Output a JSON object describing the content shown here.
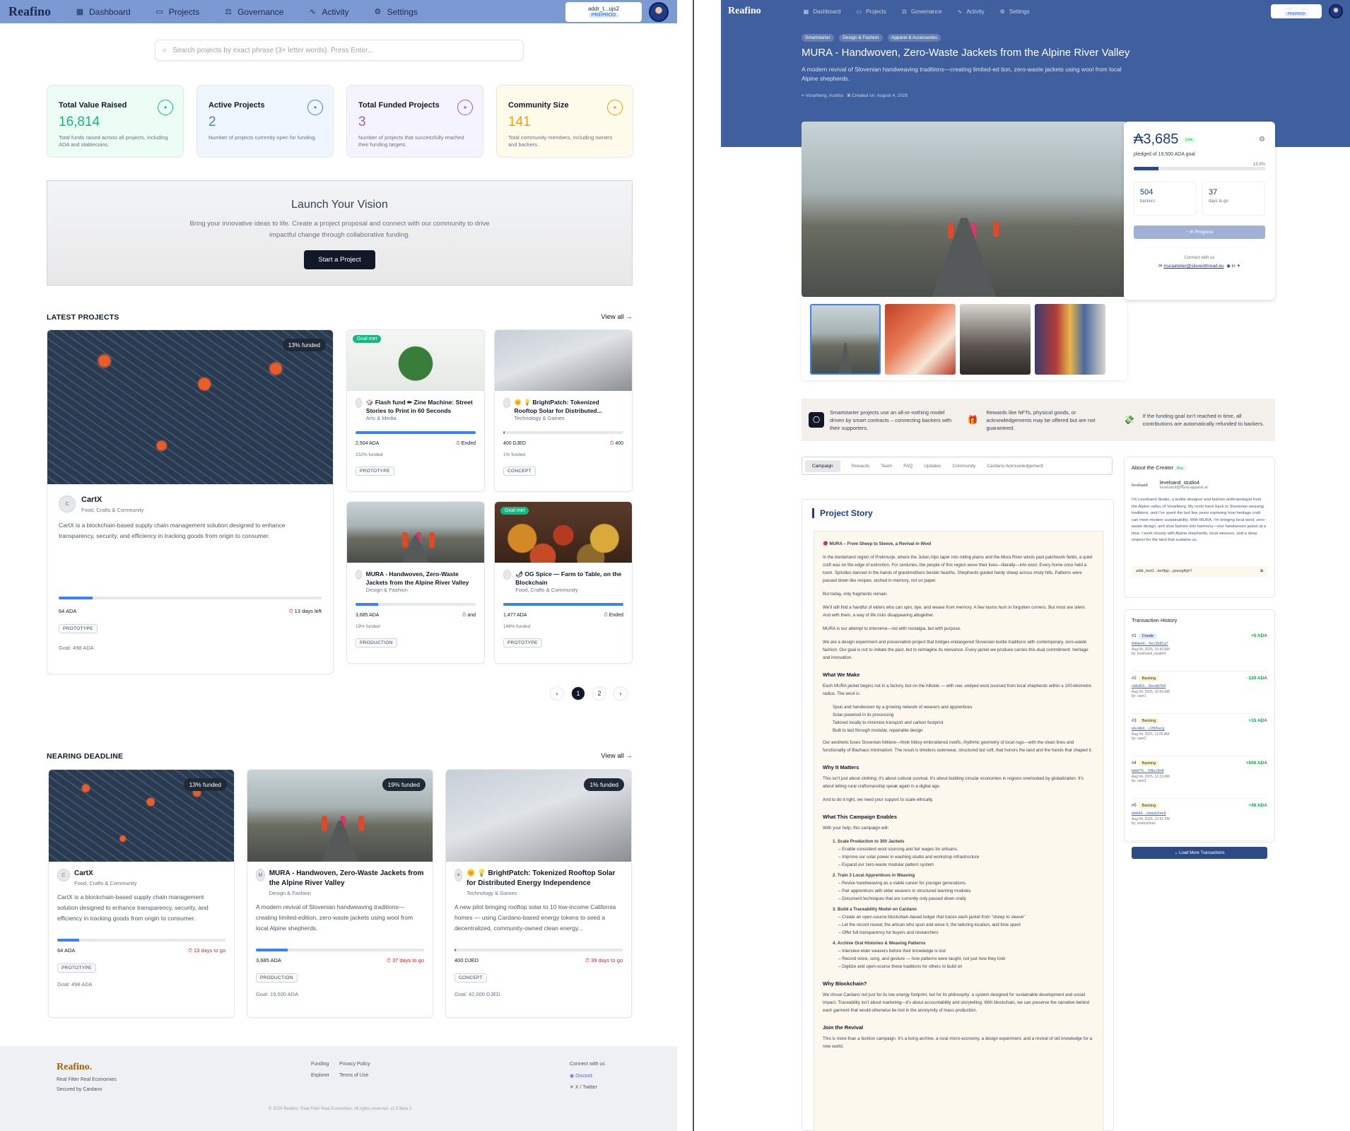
{
  "left": {
    "nav": {
      "logo": "Reafino",
      "items": [
        "Dashboard",
        "Projects",
        "Governance",
        "Activity",
        "Settings"
      ],
      "wallet_addr": "addr_t...ujs2",
      "wallet_net": "PREPROD"
    },
    "search": {
      "placeholder": "Search projects by exact phrase (3+ letter words). Press Enter..."
    },
    "stats": [
      {
        "title": "Total Value Raised",
        "value": "16,814",
        "desc": "Total funds raised across all projects, including ADA and stablecoins.",
        "color": "#10b981",
        "bg": "#ecfdf5",
        "icon": "coins-icon"
      },
      {
        "title": "Active Projects",
        "value": "2",
        "desc": "Number of projects currently open for funding.",
        "color": "#3b82f6",
        "bg": "#eff6ff",
        "icon": "activity-icon"
      },
      {
        "title": "Total Funded Projects",
        "value": "3",
        "desc": "Number of projects that successfully reached their funding targets.",
        "color": "#8b5cf6",
        "bg": "#f5f3ff",
        "icon": "check-circle-icon"
      },
      {
        "title": "Community Size",
        "value": "141",
        "desc": "Total community members, including owners and backers.",
        "color": "#f59e0b",
        "bg": "#fffbeb",
        "icon": "users-icon"
      }
    ],
    "launch": {
      "title": "Launch Your Vision",
      "text": "Bring your innovative ideas to life. Create a project proposal and connect with our community to drive impactful change through collaborative funding.",
      "button": "Start a Project"
    },
    "latest": {
      "heading": "LATEST PROJECTS",
      "view_all": "View all →",
      "featured": {
        "badge": "13% funded",
        "avatar": "C",
        "title": "CartX",
        "category": "Food, Crafts & Community",
        "desc": "CartX is a blockchain-based supply chain management solution designed to enhance transparency, security, and efficiency in tracking goods from origin to consumer.",
        "amount": "64 ADA",
        "left": "13 days left",
        "stage": "PROTOTYPE",
        "goal": "Goal: 498 ADA",
        "progress": 0.13
      },
      "cards": [
        {
          "goal_badge": "Goal met",
          "title": "🎲 Flash fund ✏ Zine Machine: Street Stories to Print in 60 Seconds",
          "category": "Arts & Media",
          "amount": "2,504 ADA",
          "status": "Ended",
          "funded": "232% funded",
          "stage": "PROTOTYPE",
          "progress": 1.0
        },
        {
          "goal_badge": "",
          "title": "🌞 💡 BrightPatch: Tokenized Rooftop Solar for Distributed...",
          "category": "Technology & Games",
          "amount": "400 DJED",
          "status": "400",
          "funded": "1% funded",
          "stage": "CONCEPT",
          "progress": 0.01
        },
        {
          "goal_badge": "",
          "title": "MURA - Handwoven, Zero-Waste Jackets from the Alpine River Valley",
          "category": "Design & Fashion",
          "amount": "3,685 ADA",
          "status": "and",
          "funded": "19% funded",
          "stage": "PRODUCTION",
          "progress": 0.19
        },
        {
          "goal_badge": "Goal met",
          "title": "🌶 OG Spice — Farm to Table, on the Blockchain",
          "category": "Food, Crafts & Community",
          "amount": "1,477 ADA",
          "status": "Ended",
          "funded": "148% funded",
          "stage": "PROTOTYPE",
          "progress": 1.0
        }
      ],
      "pages": [
        "1",
        "2"
      ]
    },
    "deadline": {
      "heading": "NEARING DEADLINE",
      "view_all": "View all →",
      "cards": [
        {
          "badge": "13% funded",
          "avatar": "C",
          "title": "CartX",
          "category": "Food, Crafts & Community",
          "desc": "CartX is a blockchain-based supply chain management solution designed to enhance transparency, security, and efficiency in tracking goods from origin to consumer.",
          "amount": "64 ADA",
          "left": "13 days to go",
          "stage": "PROTOTYPE",
          "goal": "Goal: 498 ADA",
          "progress": 0.13
        },
        {
          "badge": "19% funded",
          "avatar": "M",
          "title": "MURA - Handwoven, Zero-Waste Jackets from the Alpine River Valley",
          "category": "Design & Fashion",
          "desc": "A modern revival of Slovenian handweaving traditions—creating limited-edition, zero-waste jackets using wool from local Alpine shepherds.",
          "amount": "3,685 ADA",
          "left": "37 days to go",
          "stage": "PRODUCTION",
          "goal": "Goal: 19,500 ADA",
          "progress": 0.19
        },
        {
          "badge": "1% funded",
          "avatar": "☀",
          "title": "🌞 💡 BrightPatch: Tokenized Rooftop Solar for Distributed Energy Independence",
          "category": "Technology & Games",
          "desc": "A new pilot bringing rooftop solar to 10 low-income California homes — using Cardano-based energy tokens to seed a decentralized, community-owned clean energy...",
          "amount": "400 DJED",
          "left": "39 days to go",
          "stage": "CONCEPT",
          "goal": "Goal: 42,000 DJED",
          "progress": 0.01
        }
      ]
    },
    "footer": {
      "logo": "Reafino.",
      "tag1": "Real Filter Real Economies",
      "tag2": "Secured by Cardano",
      "links1": [
        "Funding",
        "Explorer"
      ],
      "links2": [
        "Privacy Policy",
        "Terms of Use"
      ],
      "connect": "Connect with us",
      "discord": "Discord",
      "twitter": "X / Twitter",
      "copyright": "© 2025 Reafino. Real Filter Real Economies. All rights reserved. v1.0 Beta 2"
    }
  },
  "right": {
    "nav": {
      "logo": "Reafino",
      "items": [
        "Dashboard",
        "Projects",
        "Governance",
        "Activity",
        "Settings"
      ],
      "wallet_addr": "addr_t...ujs2",
      "wallet_net": "PREPROD"
    },
    "tags": [
      "Smartstarter",
      "Design & Fashion",
      "Apparel & Accessories"
    ],
    "title": "MURA - Handwoven, Zero-Waste Jackets from the Alpine River Valley",
    "subtitle": "A modern revival of Slovenian handweaving traditions—creating limited-ed tion, zero-waste jackets using wool from local Alpine shepherds.",
    "location": "Vorarlberg, Austria",
    "created": "Created on: August 4, 2025",
    "fund": {
      "raised": "₳3,685",
      "status_badge": "Live",
      "pledged": "pledged of 19,500 ADA goal",
      "pct": "18.9%",
      "progress": 0.189,
      "backers": "504",
      "backers_label": "backers",
      "days": "37",
      "days_label": "days to go",
      "button": "In Progress",
      "connect": "Connect with us",
      "email": "muraatelier@sloventhread.eu"
    },
    "info": [
      "Smartstarter projects use an all-or-nothing model driven by smart contracts – connecting backers with their supporters.",
      "Rewards like NFTs, physical goods, or acknowledgements may be offered but are not guaranteed.",
      "If the funding goal isn't reached in time, all contributions are automatically refunded to backers."
    ],
    "tabs": [
      "Campaign",
      "Rewards",
      "Team",
      "FAQ",
      "Updates",
      "Community",
      "Cardano Acknowledgement"
    ],
    "story": {
      "heading": "Project Story",
      "intro_title": "🧶 MURA – From Sheep to Sleeve, a Revival in Wool",
      "p1": "In the borderland region of Prekmurje, where the Julian Alps taper into rolling plains and the Mura River winds past patchwork fields, a quiet craft was on the edge of extinction. For centuries, the people of this region wove their lives—literally—into wool. Every home once held a loom. Spindles danced in the hands of grandmothers beside hearths. Shepherds guided hardy sheep across misty hills. Patterns were passed down like recipes, etched in memory, not on paper.",
      "p2": "But today, only fragments remain.",
      "p3": "We'll still find a handful of elders who can spin, dye, and weave from memory. A few looms hum in forgotten corners. But most are silent. And with them, a way of life risks disappearing altogether.",
      "p4": "MURA is our attempt to intervene—not with nostalgia, but with purpose.",
      "p5": "We are a design experiment and preservation project that bridges endangered Slovenian textile traditions with contemporary, zero-waste fashion. Our goal is not to imitate the past, but to reimagine its relevance. Every jacket we produce carries this dual commitment: heritage and innovation.",
      "h1": "What We Make",
      "p6": "Each MURA jacket begins not in a factory, but on the hillside — with raw, undyed wool sourced from local shepherds within a 100-kilometre radius. The wool is:",
      "list1": [
        "Spun and handwoven by a growing network of weavers and apprentices",
        "Solar-powered in its processing",
        "Tailored locally to minimize transport and carbon footprint",
        "Built to last through modular, repairable design"
      ],
      "p7": "Our aesthetic fuses Slovenian folklore—think folksy embroidered motifs, rhythmic geometry of local rugs—with the clean lines and functionality of Bauhaus minimalism. The result is timeless outerwear, structured but soft, that honors the land and the hands that shaped it.",
      "h2": "Why It Matters",
      "p8": "This isn't just about clothing; it's about cultural survival. It's about building circular economies in regions overlooked by globalization. It's about letting rural craftsmanship speak again in a digital age.",
      "p9": "And to do it right, we need your support to scale ethically.",
      "h3": "What This Campaign Enables",
      "p10": "With your help, this campaign will:",
      "list2": [
        "1. Scale Production to 300 Jackets",
        "– Enable consistent wool sourcing and fair wages for artisans.",
        "– Improve our solar power in washing studio and workshop infrastructure",
        "– Expand our zero-waste modular pattern system",
        "2. Train 3 Local Apprentices in Weaving",
        "– Revive handweaving as a viable career for younger generations.",
        "– Pair apprentices with elder weavers in structured learning modules",
        "– Document techniques that are currently only passed down orally",
        "3. Build a Traceability Model on Cardano",
        "– Create an open-source blockchain-based ledger that traces each jacket from \"sheep to sleeve\"",
        "– Let the record reveal, the artisan who spun and wove it, the tailoring location, and time spent",
        "– Offer full transparency for buyers and researchers",
        "4. Archive Oral Histories & Weaving Patterns",
        "– Interview elder weavers before their knowledge is lost",
        "– Record voice, song, and gesture — how patterns were taught, not just how they look",
        "– Digitize and open-source these traditions for others to build on"
      ],
      "h4": "Why Blockchain?",
      "p11": "We chose Cardano not just for its low energy footprint, but for its philosophy: a system designed for sustainable development and social impact. Traceability isn't about marketing—it's about accountability and storytelling. With blockchain, we can preserve the narrative behind each garment that would otherwise be lost in the anonymity of mass production.",
      "h5": "Join the Revival",
      "p12": "This is more than a fashion campaign. It's a living archive, a rural micro-economy, a design experiment, and a revival of old knowledge for a new world."
    },
    "creator": {
      "heading": "About the Creator",
      "badge": "Pro",
      "logo": "levelsand",
      "name": "levelsand_studio4",
      "email": "levelsand@mura-apparel.at",
      "bio": "I'm Levelsand Studio, a textile designer and fashion anthropologist from the Alpine valley of Vorarlberg. My roots trace back to Slovenian weaving traditions, and I've spent the last few years exploring how heritage craft can meet modern sustainability. With MURA, I'm bringing local wool, zero-waste design, and slow fashion into harmony—one handwoven jacket at a time. I work closely with Alpine shepherds, local weavers, and a deep respect for the land that sustains us.",
      "wallet": "addr_test1...berllpp...ypsuigtfgh7"
    },
    "transactions": {
      "heading": "Transaction History",
      "items": [
        {
          "n": "#1",
          "type": "Create",
          "hash": "84bbd4....6ec2b81a7",
          "date": "Aug 04, 2025, 10:43 AM",
          "by": "by: levelsand_studio4",
          "amount": "+5 ADA",
          "color": "#16a34a",
          "bcolor": "#dbeafe"
        },
        {
          "n": "#2",
          "type": "Backing",
          "hash": "cbbd59....8ecdd7b9",
          "date": "Aug 04, 2025, 10:50 AM",
          "by": "by: user1",
          "amount": "-120 ADA",
          "color": "#16a34a",
          "bcolor": "#fef3c7"
        },
        {
          "n": "#3",
          "type": "Backing",
          "hash": "ebc4bd....c2fb5ecg",
          "date": "Aug 04, 2025, 11:05 AM",
          "by": "by: user2",
          "amount": "+15 ADA",
          "color": "#16a34a",
          "bcolor": "#fef3c7"
        },
        {
          "n": "#4",
          "type": "Backing",
          "hash": "bbbf79....34bc2b4f",
          "date": "Aug 04, 2025, 12:23 AM",
          "by": "by: user3",
          "amount": "+600 ADA",
          "color": "#16a34a",
          "bcolor": "#fef3c7"
        },
        {
          "n": "#5",
          "type": "Backing",
          "hash": "ebb84....ebacb2ee6",
          "date": "Aug 04, 2025, 12:51 PM",
          "by": "by: anonymous",
          "amount": "+48 ADA",
          "color": "#16a34a",
          "bcolor": "#fef3c7"
        }
      ],
      "load_more": "Load More Transactions"
    }
  }
}
